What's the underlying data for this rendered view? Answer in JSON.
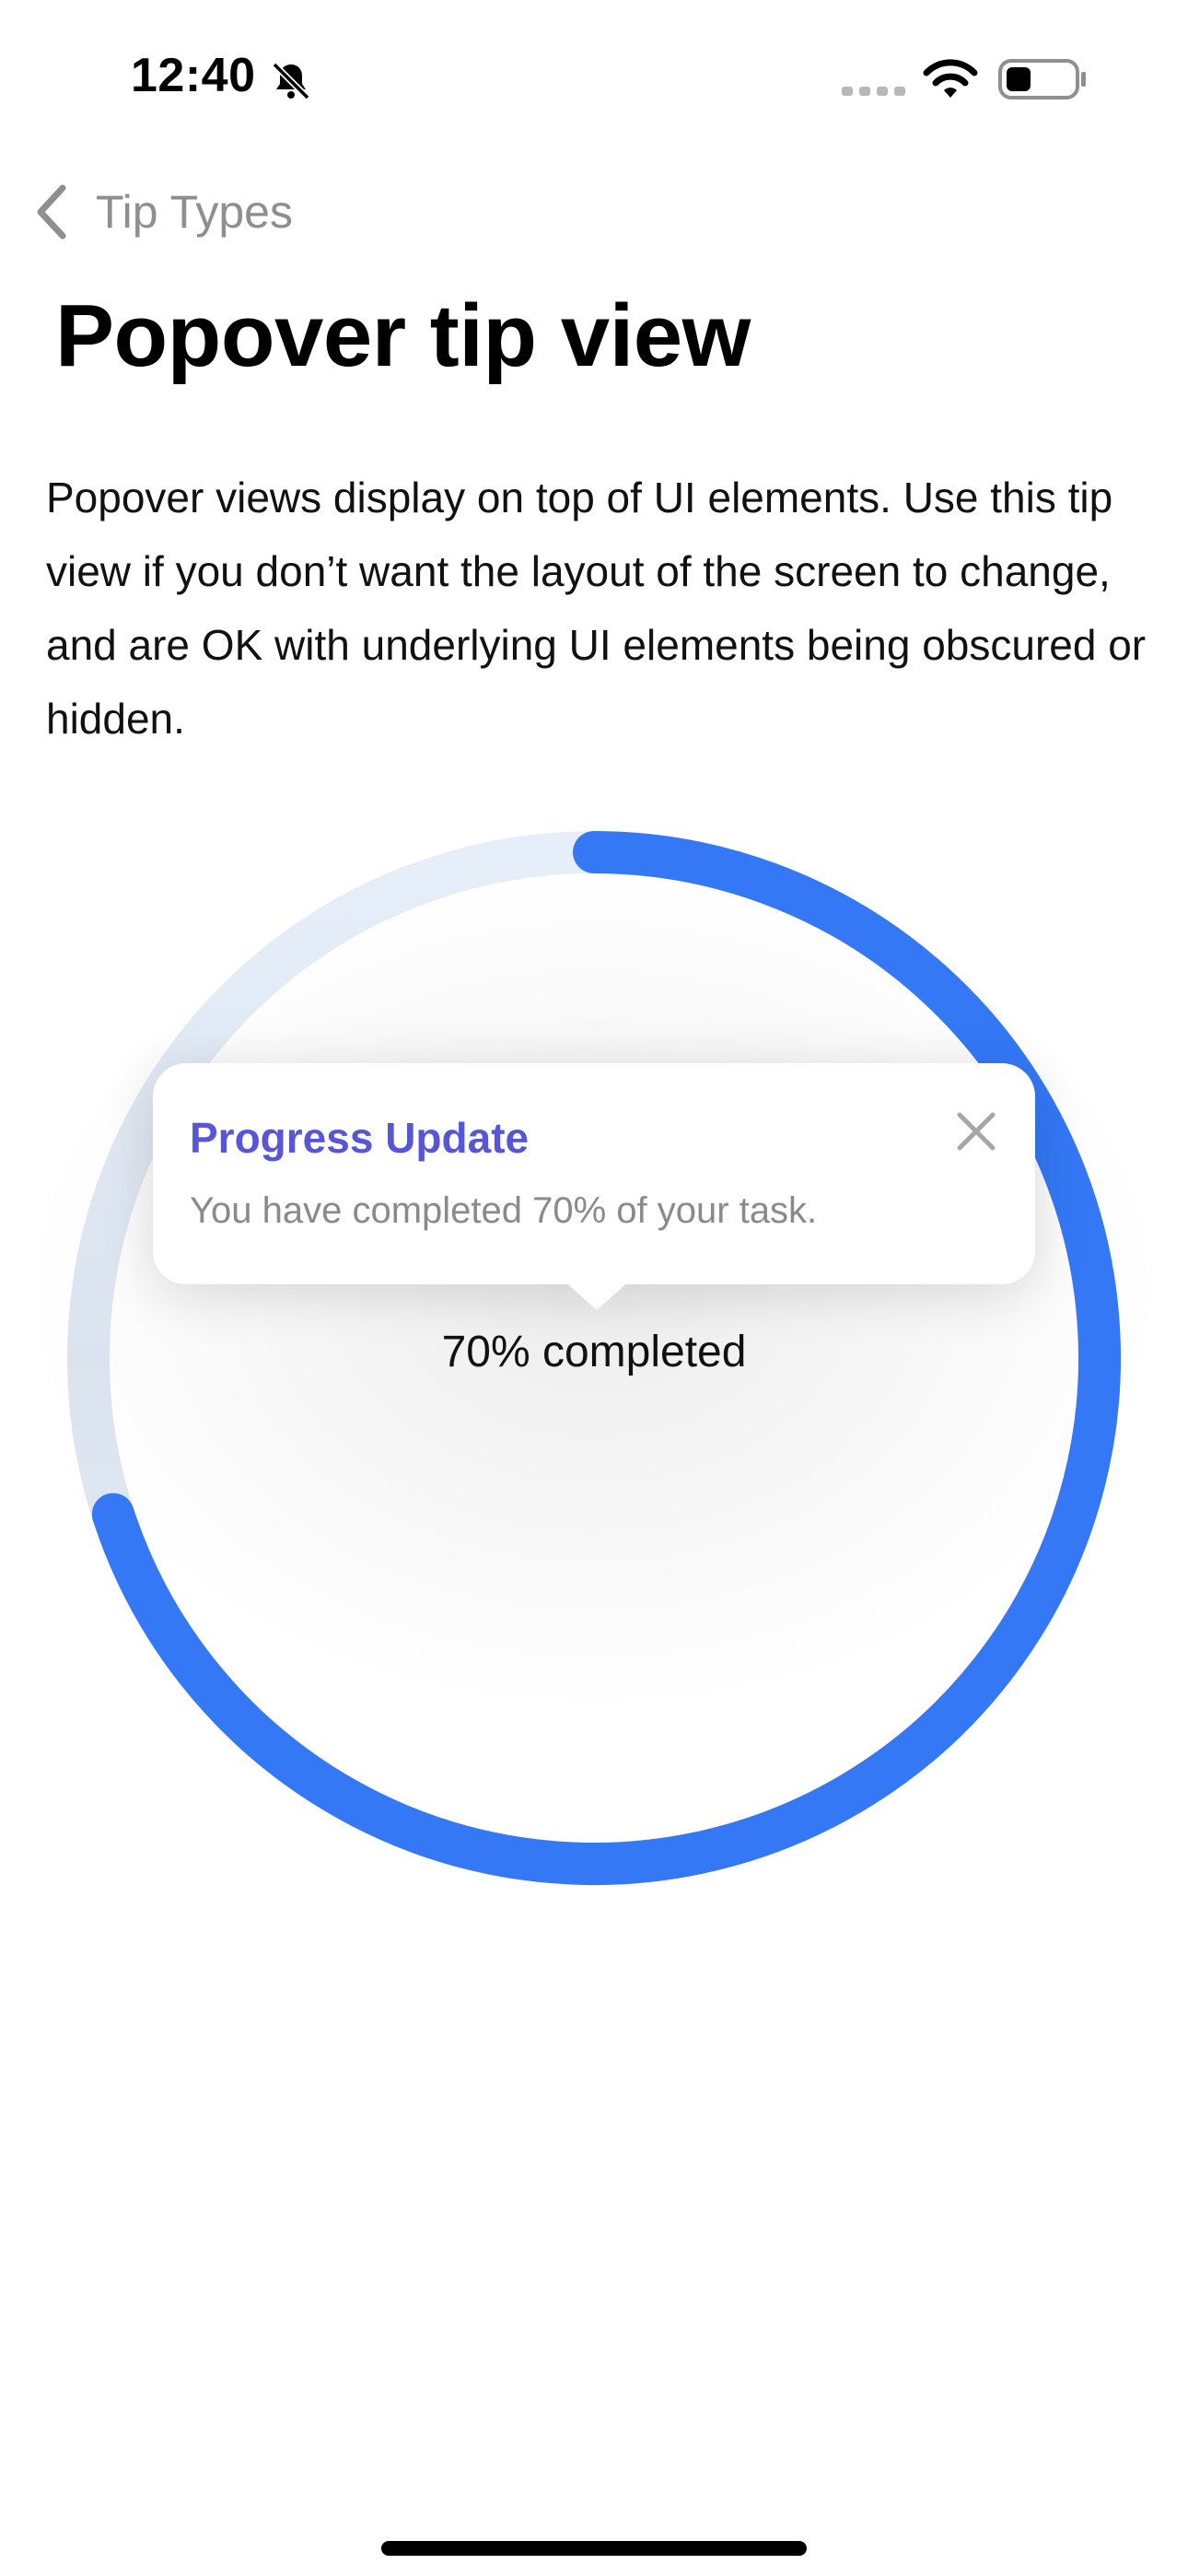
{
  "status_bar": {
    "time": "12:40",
    "silent_icon": "bell-slash-icon",
    "signal_icon": "cellular-signal-icon",
    "wifi_icon": "wifi-icon",
    "battery_icon": "battery-icon"
  },
  "nav": {
    "back_label": "Tip Types",
    "back_icon": "chevron-left-icon"
  },
  "page": {
    "title": "Popover tip view",
    "description": "Popover views display on top of UI elements. Use this tip view if you don’t want the layout of the screen to change, and are OK with underlying UI elements being obscured or hidden."
  },
  "progress": {
    "value": 0.7,
    "label": "70% completed",
    "track_color": "#e2eaf6",
    "fill_color": "#3478f6"
  },
  "tip": {
    "title": "Progress Update",
    "message": "You have completed 70% of your task.",
    "close_icon": "close-icon",
    "title_color": "#5856d6"
  }
}
